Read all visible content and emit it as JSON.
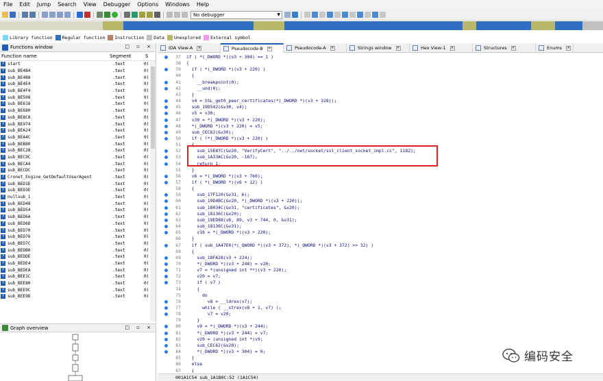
{
  "menu": [
    "File",
    "Edit",
    "Jump",
    "Search",
    "View",
    "Debugger",
    "Options",
    "Windows",
    "Help"
  ],
  "toolbar": {
    "debugger_select": "No debugger"
  },
  "legend": [
    {
      "label": "Library function",
      "color": "#7fd7f7"
    },
    {
      "label": "Regular function",
      "color": "#2f6fc4"
    },
    {
      "label": "Instruction",
      "color": "#b5816a"
    },
    {
      "label": "Data",
      "color": "#c0c0c0"
    },
    {
      "label": "Unexplored",
      "color": "#b8b868"
    },
    {
      "label": "External symbol",
      "color": "#f59ae8"
    }
  ],
  "functions_window": {
    "title": "Functions window",
    "col_name": "Function name",
    "col_segment": "Segment",
    "col_start": "S",
    "rows": [
      {
        "name": "start",
        "segment": ".text",
        "start": "0("
      },
      {
        "name": "sub_BE4B4",
        "segment": ".text",
        "start": "0("
      },
      {
        "name": "sub_BE4B8",
        "segment": ".text",
        "start": "0("
      },
      {
        "name": "sub_BE4E4",
        "segment": ".text",
        "start": "0("
      },
      {
        "name": "sub_BE4F4",
        "segment": ".text",
        "start": "0("
      },
      {
        "name": "sub_BE508",
        "segment": ".text",
        "start": "0("
      },
      {
        "name": "sub_BE618",
        "segment": ".text",
        "start": "0("
      },
      {
        "name": "sub_BE680",
        "segment": ".text",
        "start": "0("
      },
      {
        "name": "sub_BE8C8",
        "segment": ".text",
        "start": "0("
      },
      {
        "name": "sub_BE974",
        "segment": ".text",
        "start": "0("
      },
      {
        "name": "sub_BEA24",
        "segment": ".text",
        "start": "0("
      },
      {
        "name": "sub_BEA4C",
        "segment": ".text",
        "start": "0("
      },
      {
        "name": "sub_BEB80",
        "segment": ".text",
        "start": "0("
      },
      {
        "name": "sub_BEC28",
        "segment": ".text",
        "start": "0("
      },
      {
        "name": "sub_BEC9C",
        "segment": ".text",
        "start": "0("
      },
      {
        "name": "sub_BECA4",
        "segment": ".text",
        "start": "0("
      },
      {
        "name": "sub_BECDC",
        "segment": ".text",
        "start": "0("
      },
      {
        "name": "Cronet_Engine_GetDefaultUserAgent",
        "segment": ".text",
        "start": "0("
      },
      {
        "name": "sub_BED1E",
        "segment": ".text",
        "start": "0("
      },
      {
        "name": "sub_BED3E",
        "segment": ".text",
        "start": "0("
      },
      {
        "name": "nullsub_1",
        "segment": ".text",
        "start": "0("
      },
      {
        "name": "sub_BED48",
        "segment": ".text",
        "start": "0("
      },
      {
        "name": "sub_BED54",
        "segment": ".text",
        "start": "0("
      },
      {
        "name": "sub_BED6A",
        "segment": ".text",
        "start": "0("
      },
      {
        "name": "sub_BED6D",
        "segment": ".text",
        "start": "0("
      },
      {
        "name": "sub_BED70",
        "segment": ".text",
        "start": "0("
      },
      {
        "name": "sub_BED76",
        "segment": ".text",
        "start": "0("
      },
      {
        "name": "sub_BED7C",
        "segment": ".text",
        "start": "0("
      },
      {
        "name": "sub_BEDB0",
        "segment": ".text",
        "start": "0("
      },
      {
        "name": "sub_BEDDE",
        "segment": ".text",
        "start": "0("
      },
      {
        "name": "sub_BEDE4",
        "segment": ".text",
        "start": "0("
      },
      {
        "name": "sub_BEDEA",
        "segment": ".text",
        "start": "0("
      },
      {
        "name": "sub_BEE1C",
        "segment": ".text",
        "start": "0("
      },
      {
        "name": "sub_BEE80",
        "segment": ".text",
        "start": "0("
      },
      {
        "name": "sub_BEE9C",
        "segment": ".text",
        "start": "0("
      },
      {
        "name": "sub_BEE9D",
        "segment": ".text",
        "start": "0("
      }
    ]
  },
  "graph_overview": {
    "title": "Graph overview"
  },
  "tabs": [
    {
      "label": "IDA View-A",
      "active": false
    },
    {
      "label": "Pseudocode-B",
      "active": true
    },
    {
      "label": "Pseudocode-A",
      "active": false
    },
    {
      "label": "Strings window",
      "active": false
    },
    {
      "label": "Hex View-1",
      "active": false
    },
    {
      "label": "Structures",
      "active": false
    },
    {
      "label": "Enums",
      "active": false
    }
  ],
  "code_lines": [
    {
      "n": "37",
      "t": "if ( *(_DWORD *)(v3 + 304) == 1 )",
      "dot": true
    },
    {
      "n": "38",
      "t": "{",
      "dot": false
    },
    {
      "n": "39",
      "t": "  if ( *(_DWORD *)(v3 + 220) )",
      "dot": true
    },
    {
      "n": "40",
      "t": "  {",
      "dot": false
    },
    {
      "n": "41",
      "t": "    __breakpoint(0);",
      "dot": true
    },
    {
      "n": "42",
      "t": "    __und(0);",
      "dot": true
    },
    {
      "n": "43",
      "t": "  }",
      "dot": false
    },
    {
      "n": "44",
      "t": "  v4 = SSL_get0_peer_certificates(*(_DWORD *)(v3 + 328));",
      "dot": true
    },
    {
      "n": "45",
      "t": "  sub_19D542(&v30, v4);",
      "dot": true
    },
    {
      "n": "46",
      "t": "  v5 = v30;",
      "dot": true
    },
    {
      "n": "47",
      "t": "  v30 = *(_DWORD *)(v3 + 220);",
      "dot": true
    },
    {
      "n": "48",
      "t": "  *(_DWORD *)(v3 + 220) = v5;",
      "dot": true
    },
    {
      "n": "49",
      "t": "  sub_CEC62(&v30);",
      "dot": true
    },
    {
      "n": "50",
      "t": "  if ( !*(_DWORD *)(v3 + 220) )",
      "dot": true
    },
    {
      "n": "51",
      "t": "  {",
      "dot": false
    },
    {
      "n": "52",
      "t": "    sub_15E87C(&v20, \"VerifyCert\", \"../../net/socket/ssl_client_socket_impl.cc\", 1182);",
      "dot": true
    },
    {
      "n": "53",
      "t": "    sub_1A33AC(&v20, -167);",
      "dot": true
    },
    {
      "n": "54",
      "t": "    return 1;",
      "dot": true
    },
    {
      "n": "55",
      "t": "  }",
      "dot": false
    },
    {
      "n": "56",
      "t": "  v6 = *(_DWORD *)(v3 + 760);",
      "dot": true
    },
    {
      "n": "57",
      "t": "  if ( *(_DWORD *)(v6 + 12) )",
      "dot": true
    },
    {
      "n": "58",
      "t": "  {",
      "dot": false
    },
    {
      "n": "59",
      "t": "    sub_17F120(&v31, 6);",
      "dot": true
    },
    {
      "n": "60",
      "t": "    sub_19D4BC(&v20, *(_DWORD *)(v3 + 220));",
      "dot": true
    },
    {
      "n": "61",
      "t": "    sub_18034C(&v31, \"certificates\", &v20);",
      "dot": true
    },
    {
      "n": "62",
      "t": "    sub_18136C(&v20);",
      "dot": true
    },
    {
      "n": "63",
      "t": "    sub_19ED88(v6, 89, v3 + 744, 0, &v31);",
      "dot": true
    },
    {
      "n": "64",
      "t": "    sub_18136C(&v31);",
      "dot": true
    },
    {
      "n": "65",
      "t": "    v16 = *(_DWORD *)(v3 + 220);",
      "dot": true
    },
    {
      "n": "66",
      "t": "  }",
      "dot": false
    },
    {
      "n": "67",
      "t": "  if ( sub_1A47E0(*(_QWORD *)(v3 + 372), *(_QWORD *)(v3 + 372) >> 32) )",
      "dot": true
    },
    {
      "n": "68",
      "t": "  {",
      "dot": false
    },
    {
      "n": "69",
      "t": "    sub_18FA28(v3 + 224);",
      "dot": true
    },
    {
      "n": "70",
      "t": "    *(_DWORD *)(v3 + 248) = v20;",
      "dot": true
    },
    {
      "n": "71",
      "t": "    v7 = *(unsigned int **)(v3 + 220);",
      "dot": true
    },
    {
      "n": "72",
      "t": "    v20 = v7;",
      "dot": true
    },
    {
      "n": "73",
      "t": "    if ( v7 )",
      "dot": true
    },
    {
      "n": "74",
      "t": "    {",
      "dot": false
    },
    {
      "n": "75",
      "t": "      do",
      "dot": false
    },
    {
      "n": "76",
      "t": "        v8 = __ldrex(v7);",
      "dot": true
    },
    {
      "n": "77",
      "t": "      while ( __strex(v8 + 1, v7) );",
      "dot": true
    },
    {
      "n": "78",
      "t": "        v7 = v20;",
      "dot": true
    },
    {
      "n": "79",
      "t": "    }",
      "dot": false
    },
    {
      "n": "80",
      "t": "    v9 = *(_DWORD *)(v3 + 244);",
      "dot": true
    },
    {
      "n": "81",
      "t": "    *(_DWORD *)(v3 + 244) = v7;",
      "dot": true
    },
    {
      "n": "82",
      "t": "    v20 = (unsigned int *)v9;",
      "dot": true
    },
    {
      "n": "83",
      "t": "    sub_CEC62(&v20);",
      "dot": true
    },
    {
      "n": "84",
      "t": "    *(_DWORD *)(v3 + 304) = 0;",
      "dot": true
    },
    {
      "n": "85",
      "t": "  }",
      "dot": false
    },
    {
      "n": "86",
      "t": "  else",
      "dot": false
    },
    {
      "n": "87",
      "t": "  {",
      "dot": false
    }
  ],
  "status_bar": "001A1C54 sub_1A1B0C:52 (1A1C54)",
  "watermark": "编码安全"
}
